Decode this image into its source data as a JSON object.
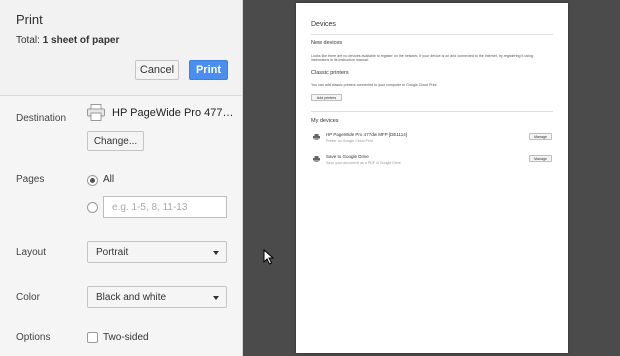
{
  "dialog": {
    "title": "Print",
    "total_prefix": "Total:",
    "total_value": "1 sheet of paper",
    "cancel_label": "Cancel",
    "print_label": "Print"
  },
  "settings": {
    "destination": {
      "label": "Destination",
      "printer_name": "HP PageWide Pro 477…",
      "change_label": "Change..."
    },
    "pages": {
      "label": "Pages",
      "option_all": "All",
      "custom_placeholder": "e.g. 1-5, 8, 11-13",
      "selected": "All"
    },
    "layout": {
      "label": "Layout",
      "value": "Portrait"
    },
    "color": {
      "label": "Color",
      "value": "Black and white"
    },
    "options": {
      "label": "Options",
      "two_sided_label": "Two-sided",
      "two_sided_checked": false
    }
  },
  "preview": {
    "title": "Devices",
    "new_devices_heading": "New devices",
    "new_devices_text": "Looks like there are no devices available to register on the network. If your device is on and connected to the internet, try registering it using instructions in its instruction manual.",
    "classic_heading": "Classic printers",
    "classic_text": "You can add classic printers connected to your computer to Google Cloud Print.",
    "add_printers_label": "Add printers",
    "my_devices_heading": "My devices",
    "devices": [
      {
        "name": "HP PageWide Pro 477dw MFP [DE1114]",
        "sub": "Printer on Google Cloud Print",
        "manage": "Manage"
      },
      {
        "name": "Save to Google Drive",
        "sub": "Save your document as a PDF in Google Drive",
        "manage": "Manage"
      }
    ]
  },
  "colors": {
    "accent": "#4a8ef0",
    "panel_bg": "#f5f5f5",
    "preview_bg": "#4b4b4b"
  },
  "icons": [
    "printer-icon",
    "dropdown-caret-icon",
    "mouse-cursor-icon"
  ]
}
